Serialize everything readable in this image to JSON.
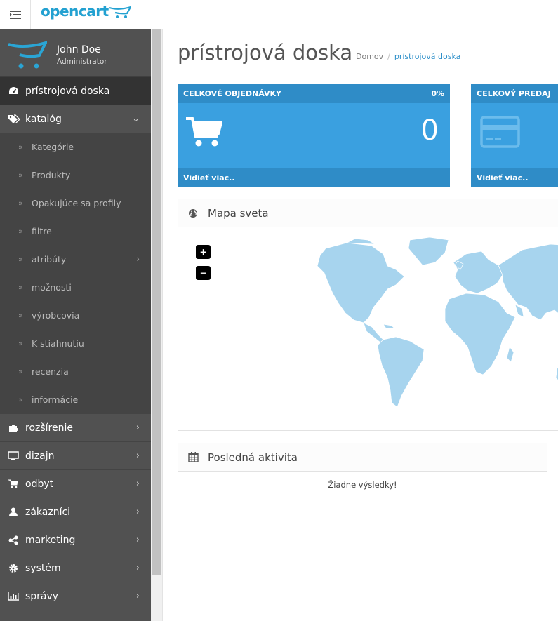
{
  "app": {
    "logo_text": "opencart"
  },
  "profile": {
    "name": "John Doe",
    "role": "Administrator"
  },
  "sidebar": {
    "items": [
      {
        "label": "prístrojová doska",
        "icon": "dashboard-icon",
        "active": true
      },
      {
        "label": "katalóg",
        "icon": "tags-icon",
        "expanded": true
      },
      {
        "label": "rozšírenie",
        "icon": "puzzle-icon"
      },
      {
        "label": "dizajn",
        "icon": "monitor-icon"
      },
      {
        "label": "odbyt",
        "icon": "cart-icon"
      },
      {
        "label": "zákazníci",
        "icon": "user-icon"
      },
      {
        "label": "marketing",
        "icon": "share-icon"
      },
      {
        "label": "systém",
        "icon": "gear-icon"
      },
      {
        "label": "správy",
        "icon": "bar-chart-icon"
      }
    ],
    "catalog_sub": [
      {
        "label": "Kategórie"
      },
      {
        "label": "Produkty"
      },
      {
        "label": "Opakujúce sa profily"
      },
      {
        "label": "filtre"
      },
      {
        "label": "atribúty",
        "has_children": true
      },
      {
        "label": "možnosti"
      },
      {
        "label": "výrobcovia"
      },
      {
        "label": "K stiahnutiu"
      },
      {
        "label": "recenzia"
      },
      {
        "label": "informácie"
      }
    ]
  },
  "page": {
    "title": "prístrojová doska"
  },
  "breadcrumb": {
    "home": "Domov",
    "separator": "/",
    "current": "prístrojová doska"
  },
  "tiles": {
    "orders": {
      "title": "CELKOVÉ OBJEDNÁVKY",
      "percent": "0%",
      "value": "0",
      "more": "Vidieť viac.."
    },
    "sales": {
      "title": "CELKOVÝ PREDAJ",
      "more": "Vidieť viac.."
    }
  },
  "map_panel": {
    "title": "Mapa sveta",
    "zoom_in": "+",
    "zoom_out": "−"
  },
  "activity_panel": {
    "title": "Posledná aktivita",
    "empty": "Žiadne výsledky!"
  },
  "colors": {
    "accent": "#23a1d1",
    "tile": "#3aa0e0",
    "tile_dark": "#2f8cc7",
    "sidebar": "#515151",
    "map_land": "#a7d4ee"
  }
}
